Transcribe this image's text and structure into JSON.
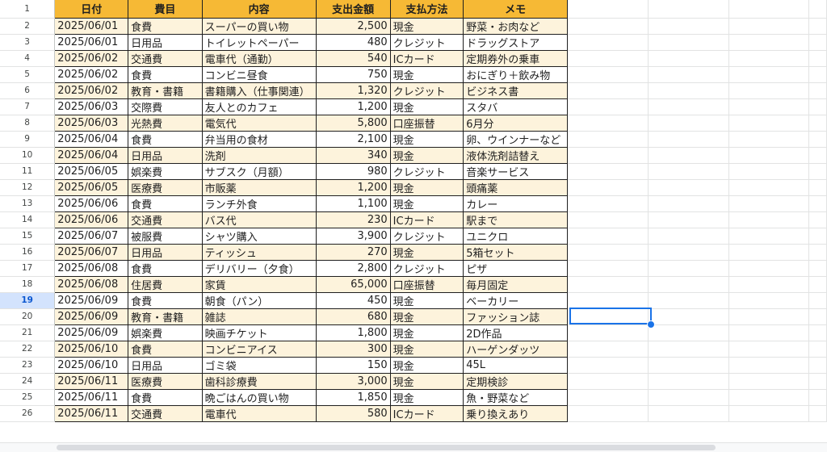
{
  "headers": [
    "日付",
    "費目",
    "内容",
    "支出金額",
    "支払方法",
    "メモ"
  ],
  "selected_row": 19,
  "colors": {
    "header_bg": "#f6b935",
    "band_bg": "#fdf3dc",
    "selection": "#1a73e8"
  },
  "rows": [
    {
      "n": "2",
      "date": "2025/06/01",
      "cat": "食費",
      "desc": "スーパーの買い物",
      "amt": "2,500",
      "pay": "現金",
      "memo": "野菜・お肉など"
    },
    {
      "n": "3",
      "date": "2025/06/01",
      "cat": "日用品",
      "desc": "トイレットペーパー",
      "amt": "480",
      "pay": "クレジット",
      "memo": "ドラッグストア"
    },
    {
      "n": "4",
      "date": "2025/06/02",
      "cat": "交通費",
      "desc": "電車代（通勤）",
      "amt": "540",
      "pay": "ICカード",
      "memo": "定期券外の乗車"
    },
    {
      "n": "5",
      "date": "2025/06/02",
      "cat": "食費",
      "desc": "コンビニ昼食",
      "amt": "750",
      "pay": "現金",
      "memo": "おにぎり＋飲み物"
    },
    {
      "n": "6",
      "date": "2025/06/02",
      "cat": "教育・書籍",
      "desc": "書籍購入（仕事関連）",
      "amt": "1,320",
      "pay": "クレジット",
      "memo": "ビジネス書"
    },
    {
      "n": "7",
      "date": "2025/06/03",
      "cat": "交際費",
      "desc": "友人とのカフェ",
      "amt": "1,200",
      "pay": "現金",
      "memo": "スタバ"
    },
    {
      "n": "8",
      "date": "2025/06/03",
      "cat": "光熱費",
      "desc": "電気代",
      "amt": "5,800",
      "pay": "口座振替",
      "memo": "6月分"
    },
    {
      "n": "9",
      "date": "2025/06/04",
      "cat": "食費",
      "desc": "弁当用の食材",
      "amt": "2,100",
      "pay": "現金",
      "memo": "卵、ウインナーなど"
    },
    {
      "n": "10",
      "date": "2025/06/04",
      "cat": "日用品",
      "desc": "洗剤",
      "amt": "340",
      "pay": "現金",
      "memo": "液体洗剤詰替え"
    },
    {
      "n": "11",
      "date": "2025/06/05",
      "cat": "娯楽費",
      "desc": "サブスク（月額）",
      "amt": "980",
      "pay": "クレジット",
      "memo": "音楽サービス"
    },
    {
      "n": "12",
      "date": "2025/06/05",
      "cat": "医療費",
      "desc": "市販薬",
      "amt": "1,200",
      "pay": "現金",
      "memo": "頭痛薬"
    },
    {
      "n": "13",
      "date": "2025/06/06",
      "cat": "食費",
      "desc": "ランチ外食",
      "amt": "1,100",
      "pay": "現金",
      "memo": "カレー"
    },
    {
      "n": "14",
      "date": "2025/06/06",
      "cat": "交通費",
      "desc": "バス代",
      "amt": "230",
      "pay": "ICカード",
      "memo": "駅まで"
    },
    {
      "n": "15",
      "date": "2025/06/07",
      "cat": "被服費",
      "desc": "シャツ購入",
      "amt": "3,900",
      "pay": "クレジット",
      "memo": "ユニクロ"
    },
    {
      "n": "16",
      "date": "2025/06/07",
      "cat": "日用品",
      "desc": "ティッシュ",
      "amt": "270",
      "pay": "現金",
      "memo": "5箱セット"
    },
    {
      "n": "17",
      "date": "2025/06/08",
      "cat": "食費",
      "desc": "デリバリー（夕食）",
      "amt": "2,800",
      "pay": "クレジット",
      "memo": "ピザ"
    },
    {
      "n": "18",
      "date": "2025/06/08",
      "cat": "住居費",
      "desc": "家賃",
      "amt": "65,000",
      "pay": "口座振替",
      "memo": "毎月固定"
    },
    {
      "n": "19",
      "date": "2025/06/09",
      "cat": "食費",
      "desc": "朝食（パン）",
      "amt": "450",
      "pay": "現金",
      "memo": "ベーカリー"
    },
    {
      "n": "20",
      "date": "2025/06/09",
      "cat": "教育・書籍",
      "desc": "雑誌",
      "amt": "680",
      "pay": "現金",
      "memo": "ファッション誌"
    },
    {
      "n": "21",
      "date": "2025/06/09",
      "cat": "娯楽費",
      "desc": "映画チケット",
      "amt": "1,800",
      "pay": "現金",
      "memo": "2D作品"
    },
    {
      "n": "22",
      "date": "2025/06/10",
      "cat": "食費",
      "desc": "コンビニアイス",
      "amt": "300",
      "pay": "現金",
      "memo": "ハーゲンダッツ"
    },
    {
      "n": "23",
      "date": "2025/06/10",
      "cat": "日用品",
      "desc": "ゴミ袋",
      "amt": "150",
      "pay": "現金",
      "memo": "45L"
    },
    {
      "n": "24",
      "date": "2025/06/11",
      "cat": "医療費",
      "desc": "歯科診療費",
      "amt": "3,000",
      "pay": "現金",
      "memo": "定期検診"
    },
    {
      "n": "25",
      "date": "2025/06/11",
      "cat": "食費",
      "desc": "晩ごはんの買い物",
      "amt": "1,850",
      "pay": "現金",
      "memo": "魚・野菜など"
    },
    {
      "n": "26",
      "date": "2025/06/11",
      "cat": "交通費",
      "desc": "電車代",
      "amt": "580",
      "pay": "ICカード",
      "memo": "乗り換えあり"
    }
  ]
}
